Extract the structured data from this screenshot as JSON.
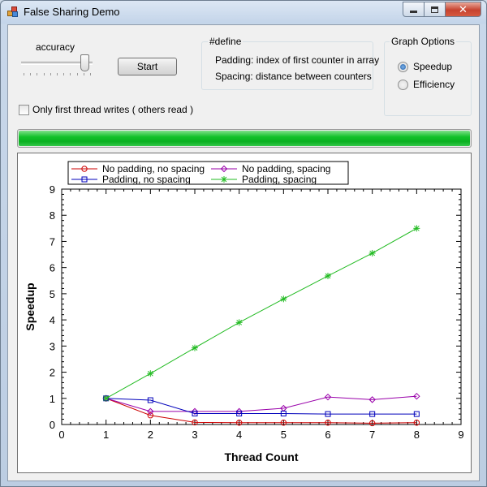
{
  "window": {
    "title": "False Sharing Demo"
  },
  "controls": {
    "accuracy_label": "accuracy",
    "accuracy_level": 1.0,
    "start_label": "Start",
    "only_first_label": "Only first thread writes ( others read )",
    "only_first_checked": false,
    "progress": 1.0
  },
  "define": {
    "title": "#define",
    "padding_text": "Padding: index of first counter in array",
    "spacing_text": "Spacing: distance between counters"
  },
  "graph_options": {
    "title": "Graph Options",
    "options": [
      {
        "label": "Speedup",
        "selected": true
      },
      {
        "label": "Efficiency",
        "selected": false
      }
    ]
  },
  "chart_data": {
    "type": "line",
    "xlabel": "Thread Count",
    "ylabel": "Speedup",
    "xlim": [
      0,
      9
    ],
    "ylim": [
      0,
      9
    ],
    "xticks": [
      0,
      1,
      2,
      3,
      4,
      5,
      6,
      7,
      8,
      9
    ],
    "yticks": [
      0,
      1,
      2,
      3,
      4,
      5,
      6,
      7,
      8,
      9
    ],
    "legend_position": "top",
    "x": [
      1,
      2,
      3,
      4,
      5,
      6,
      7,
      8
    ],
    "series": [
      {
        "name": "No padding, no spacing",
        "color": "#cc0000",
        "marker": "circle",
        "values": [
          1.0,
          0.35,
          0.08,
          0.07,
          0.07,
          0.07,
          0.05,
          0.07
        ]
      },
      {
        "name": "No padding, spacing",
        "color": "#9900aa",
        "marker": "diamond",
        "values": [
          1.0,
          0.5,
          0.5,
          0.5,
          0.62,
          1.05,
          0.95,
          1.08
        ]
      },
      {
        "name": "Padding, no spacing",
        "color": "#0000bb",
        "marker": "square",
        "values": [
          1.0,
          0.93,
          0.42,
          0.42,
          0.42,
          0.4,
          0.4,
          0.4
        ]
      },
      {
        "name": "Padding, spacing",
        "color": "#22bb22",
        "marker": "asterisk",
        "values": [
          1.0,
          1.95,
          2.93,
          3.9,
          4.8,
          5.68,
          6.55,
          7.5
        ]
      }
    ]
  }
}
